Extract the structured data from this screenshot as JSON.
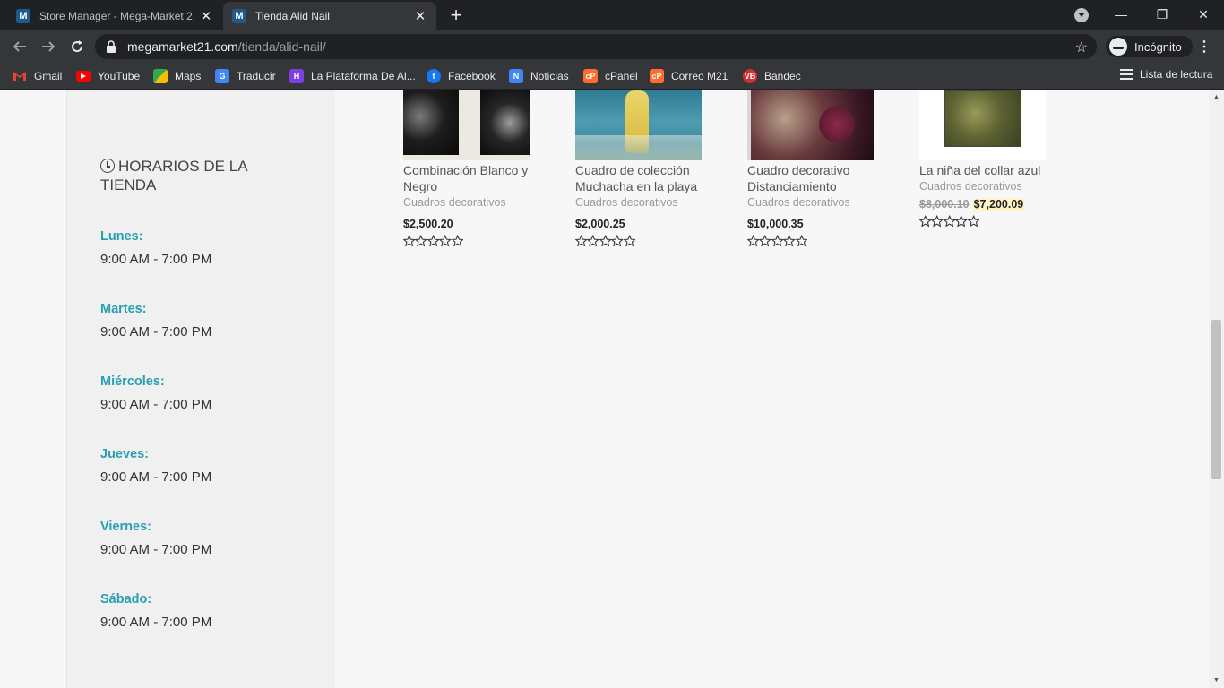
{
  "browser": {
    "tabs": [
      {
        "title": "Store Manager - Mega-Market 2",
        "favicon": "M",
        "active": false
      },
      {
        "title": "Tienda Alid Nail",
        "favicon": "M",
        "active": true
      }
    ],
    "url_host": "megamarket21.com",
    "url_path": "/tienda/alid-nail/",
    "incognito_label": "Incógnito",
    "bookmarks": [
      {
        "label": "Gmail",
        "icon": "gmail-icon",
        "color": "#ea4335"
      },
      {
        "label": "YouTube",
        "icon": "youtube-icon",
        "color": "#ff0000"
      },
      {
        "label": "Maps",
        "icon": "maps-icon",
        "color": "#34a853"
      },
      {
        "label": "Traducir",
        "icon": "translate-icon",
        "color": "#4285f4"
      },
      {
        "label": "La Plataforma De Al...",
        "icon": "plataforma-icon",
        "color": "#7b3fe4"
      },
      {
        "label": "Facebook",
        "icon": "facebook-icon",
        "color": "#1877f2"
      },
      {
        "label": "Noticias",
        "icon": "news-icon",
        "color": "#4285f4"
      },
      {
        "label": "cPanel",
        "icon": "cpanel-icon",
        "color": "#ff6c2c"
      },
      {
        "label": "Correo M21",
        "icon": "cpanel-icon",
        "color": "#ff6c2c"
      },
      {
        "label": "Bandec",
        "icon": "bandec-icon",
        "color": "#d32f2f"
      }
    ],
    "reading_list_label": "Lista de lectura"
  },
  "sidebar": {
    "title": "HORARIOS DE LA TIENDA",
    "days": [
      {
        "name": "Lunes:",
        "hours": "9:00 AM - 7:00 PM"
      },
      {
        "name": "Martes:",
        "hours": "9:00 AM - 7:00 PM"
      },
      {
        "name": "Miércoles:",
        "hours": "9:00 AM - 7:00 PM"
      },
      {
        "name": "Jueves:",
        "hours": "9:00 AM - 7:00 PM"
      },
      {
        "name": "Viernes:",
        "hours": "9:00 AM - 7:00 PM"
      },
      {
        "name": "Sábado:",
        "hours": "9:00 AM - 7:00 PM"
      }
    ]
  },
  "products": [
    {
      "title": "Combinación Blanco y Negro",
      "category": "Cuadros decorativos",
      "price": "$2,500.20",
      "old_price": "",
      "rating": 0
    },
    {
      "title": "Cuadro de colección Muchacha en la playa",
      "category": "Cuadros decorativos",
      "price": "$2,000.25",
      "old_price": "",
      "rating": 0
    },
    {
      "title": "Cuadro decorativo Distanciamiento",
      "category": "Cuadros decorativos",
      "price": "$10,000.35",
      "old_price": "",
      "rating": 0
    },
    {
      "title": "La niña del collar azul",
      "category": "Cuadros decorativos",
      "price": "$7,200.09",
      "old_price": "$8,000.10",
      "rating": 0
    }
  ],
  "colors": {
    "accent_day": "#2a9fb4",
    "sale_highlight": "#fff4c8"
  }
}
